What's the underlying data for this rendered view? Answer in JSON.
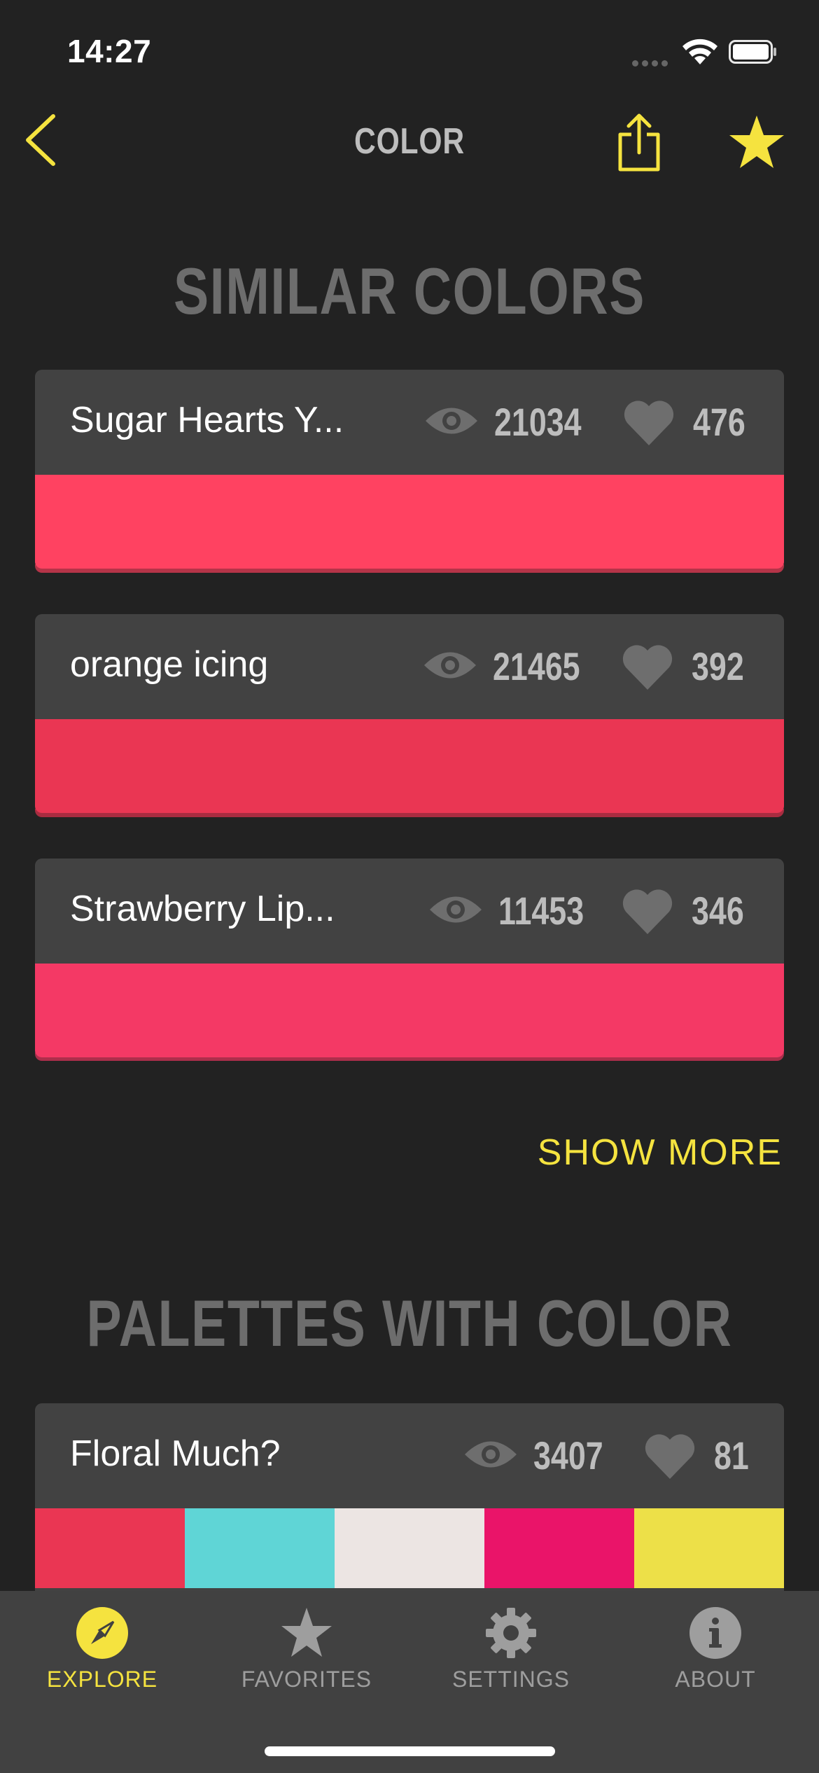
{
  "status": {
    "time": "14:27"
  },
  "nav": {
    "title": "COLOR"
  },
  "similar": {
    "title": "SIMILAR COLORS",
    "items": [
      {
        "name": "Sugar Hearts Y...",
        "views": "21034",
        "likes": "476",
        "color": "#ff4261",
        "shadow": "#b53448"
      },
      {
        "name": "orange icing",
        "views": "21465",
        "likes": "392",
        "color": "#ea3653",
        "shadow": "#a92c40"
      },
      {
        "name": "Strawberry Lip...",
        "views": "11453",
        "likes": "346",
        "color": "#f43965",
        "shadow": "#ad2e4b"
      }
    ],
    "show_more": "SHOW MORE"
  },
  "palettes": {
    "title": "PALETTES WITH COLOR",
    "items": [
      {
        "name": "Floral Much?",
        "views": "3407",
        "likes": "81",
        "colors": [
          "#ea3653",
          "#5fd5d6",
          "#ece5e3",
          "#ea1469",
          "#ede048"
        ]
      }
    ]
  },
  "tabs": [
    {
      "label": "EXPLORE",
      "icon": "compass-icon",
      "active": true
    },
    {
      "label": "FAVORITES",
      "icon": "star-icon",
      "active": false
    },
    {
      "label": "SETTINGS",
      "icon": "gear-icon",
      "active": false
    },
    {
      "label": "ABOUT",
      "icon": "info-icon",
      "active": false
    }
  ],
  "colors": {
    "accent": "#f5e33f",
    "background": "#222222",
    "card": "#424242"
  }
}
